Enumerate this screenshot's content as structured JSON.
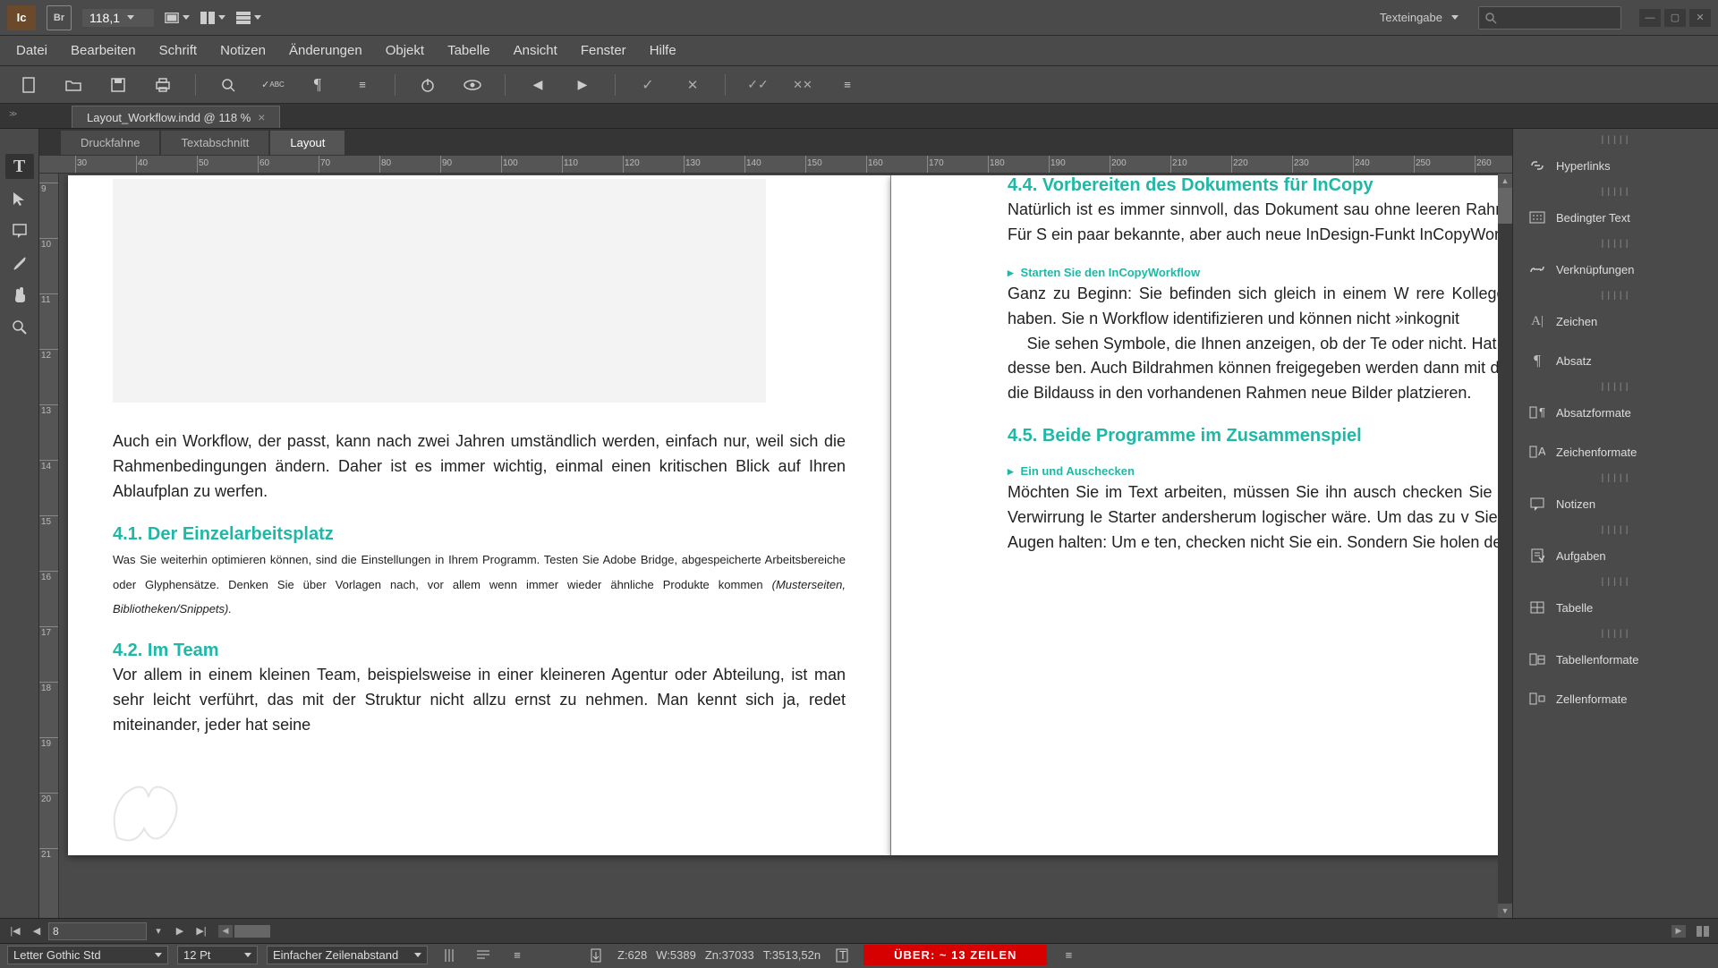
{
  "app_icon_label": "Ic",
  "zoom": "118,1",
  "workspace": "Texteingabe",
  "menus": [
    "Datei",
    "Bearbeiten",
    "Schrift",
    "Notizen",
    "Änderungen",
    "Objekt",
    "Tabelle",
    "Ansicht",
    "Fenster",
    "Hilfe"
  ],
  "doc_tab": "Layout_Workflow.indd @ 118 %",
  "view_tabs": [
    "Druckfahne",
    "Textabschnitt",
    "Layout"
  ],
  "ruler_h": [
    "30",
    "40",
    "50",
    "60",
    "70",
    "80",
    "90",
    "100",
    "110",
    "120",
    "130",
    "140",
    "150",
    "160",
    "170",
    "180",
    "190",
    "200",
    "210",
    "220",
    "230",
    "240",
    "250",
    "260"
  ],
  "ruler_v": [
    "9",
    "10",
    "11",
    "12",
    "13",
    "14",
    "15",
    "16",
    "17",
    "18",
    "19",
    "20",
    "21"
  ],
  "page_left": {
    "intro": "Auch ein Workflow, der passt, kann nach zwei Jahren umständlich werden, einfach nur, weil sich die Rahmenbedingungen ändern. Daher ist es immer wichtig, einmal einen kritischen Blick auf Ihren Ablaufplan zu werfen.",
    "h41": "4.1.   Der Einzelarbeitsplatz",
    "p41a": "Was Sie weiterhin optimieren können, sind die Einstellungen in Ihrem Programm. Testen Sie Adobe Bridge, abgespeicherte Arbeitsbereiche oder Glyphensätze. Denken Sie über Vorlagen nach, vor allem wenn immer wie­der ähnliche Produkte kommen ",
    "p41b": "(Musterseiten, Bibliotheken/Snippets).",
    "h42": "4.2.   Im Team",
    "p42": "Vor allem in einem kleinen Team, beispielsweise in einer kleineren Agentur oder Abteilung, ist man sehr leicht verführt, das mit der Struktur nicht all­zu ernst zu nehmen. Man kennt sich ja, redet miteinander, jeder hat seine"
  },
  "page_right": {
    "h44": "4.4.   Vorbereiten des Dokuments für InCopy",
    "p44": "Natürlich ist es immer sinnvoll, das Dokument sau ohne leeren Rahmen, unnütze Hilfslinien usw. Für S ein paar bekannte, aber auch neue InDesign-Funkt InCopyWorkflow benötigen.",
    "sh44a": "Starten Sie den InCopyWorkflow",
    "p44a": "Ganz zu Beginn: Sie befinden sich gleich in einem W rere Kollegen Zugriff auf ein Dokument haben. Sie n Workflow identifizieren und können nicht »inkognit",
    "p44b": "Sie sehen Symbole, die Ihnen anzeigen, ob der Te oder nicht. Hat ein Rahmen kein Symbol, ist desse ben. Auch Bildrahmen können freigegeben werden dann mit dem Positionierungswerkzeug die Bildauss in den vorhandenen Rahmen neue Bilder platzieren.",
    "h45": "4.5.   Beide Programme im Zusammenspiel",
    "sh45a": "Ein und Auschecken",
    "p45": "Möchten Sie im Text arbeiten, müssen Sie ihn ausch checken Sie ihn wieder ein. Das kann zu Verwirrung le Starter andersherum logischer wäre. Um das zu v Sie sich eigentlich nur eines vor Augen halten: Um e ten, checken nicht Sie ein. Sondern Sie holen den"
  },
  "panels": [
    "Hyperlinks",
    "Bedingter Text",
    "Verknüpfungen",
    "Zeichen",
    "Absatz",
    "Absatzformate",
    "Zeichenformate",
    "Notizen",
    "Aufgaben",
    "Tabelle",
    "Tabellenformate",
    "Zellenformate"
  ],
  "page_nav_value": "8",
  "status": {
    "font": "Letter Gothic Std",
    "size": "12 Pt",
    "leading": "Einfacher Zeilenabstand",
    "z": "Z:628",
    "w": "W:5389",
    "zn": "Zn:37033",
    "t": "T:3513,52n",
    "over": "ÜBER:  ~ 13 ZEILEN"
  }
}
